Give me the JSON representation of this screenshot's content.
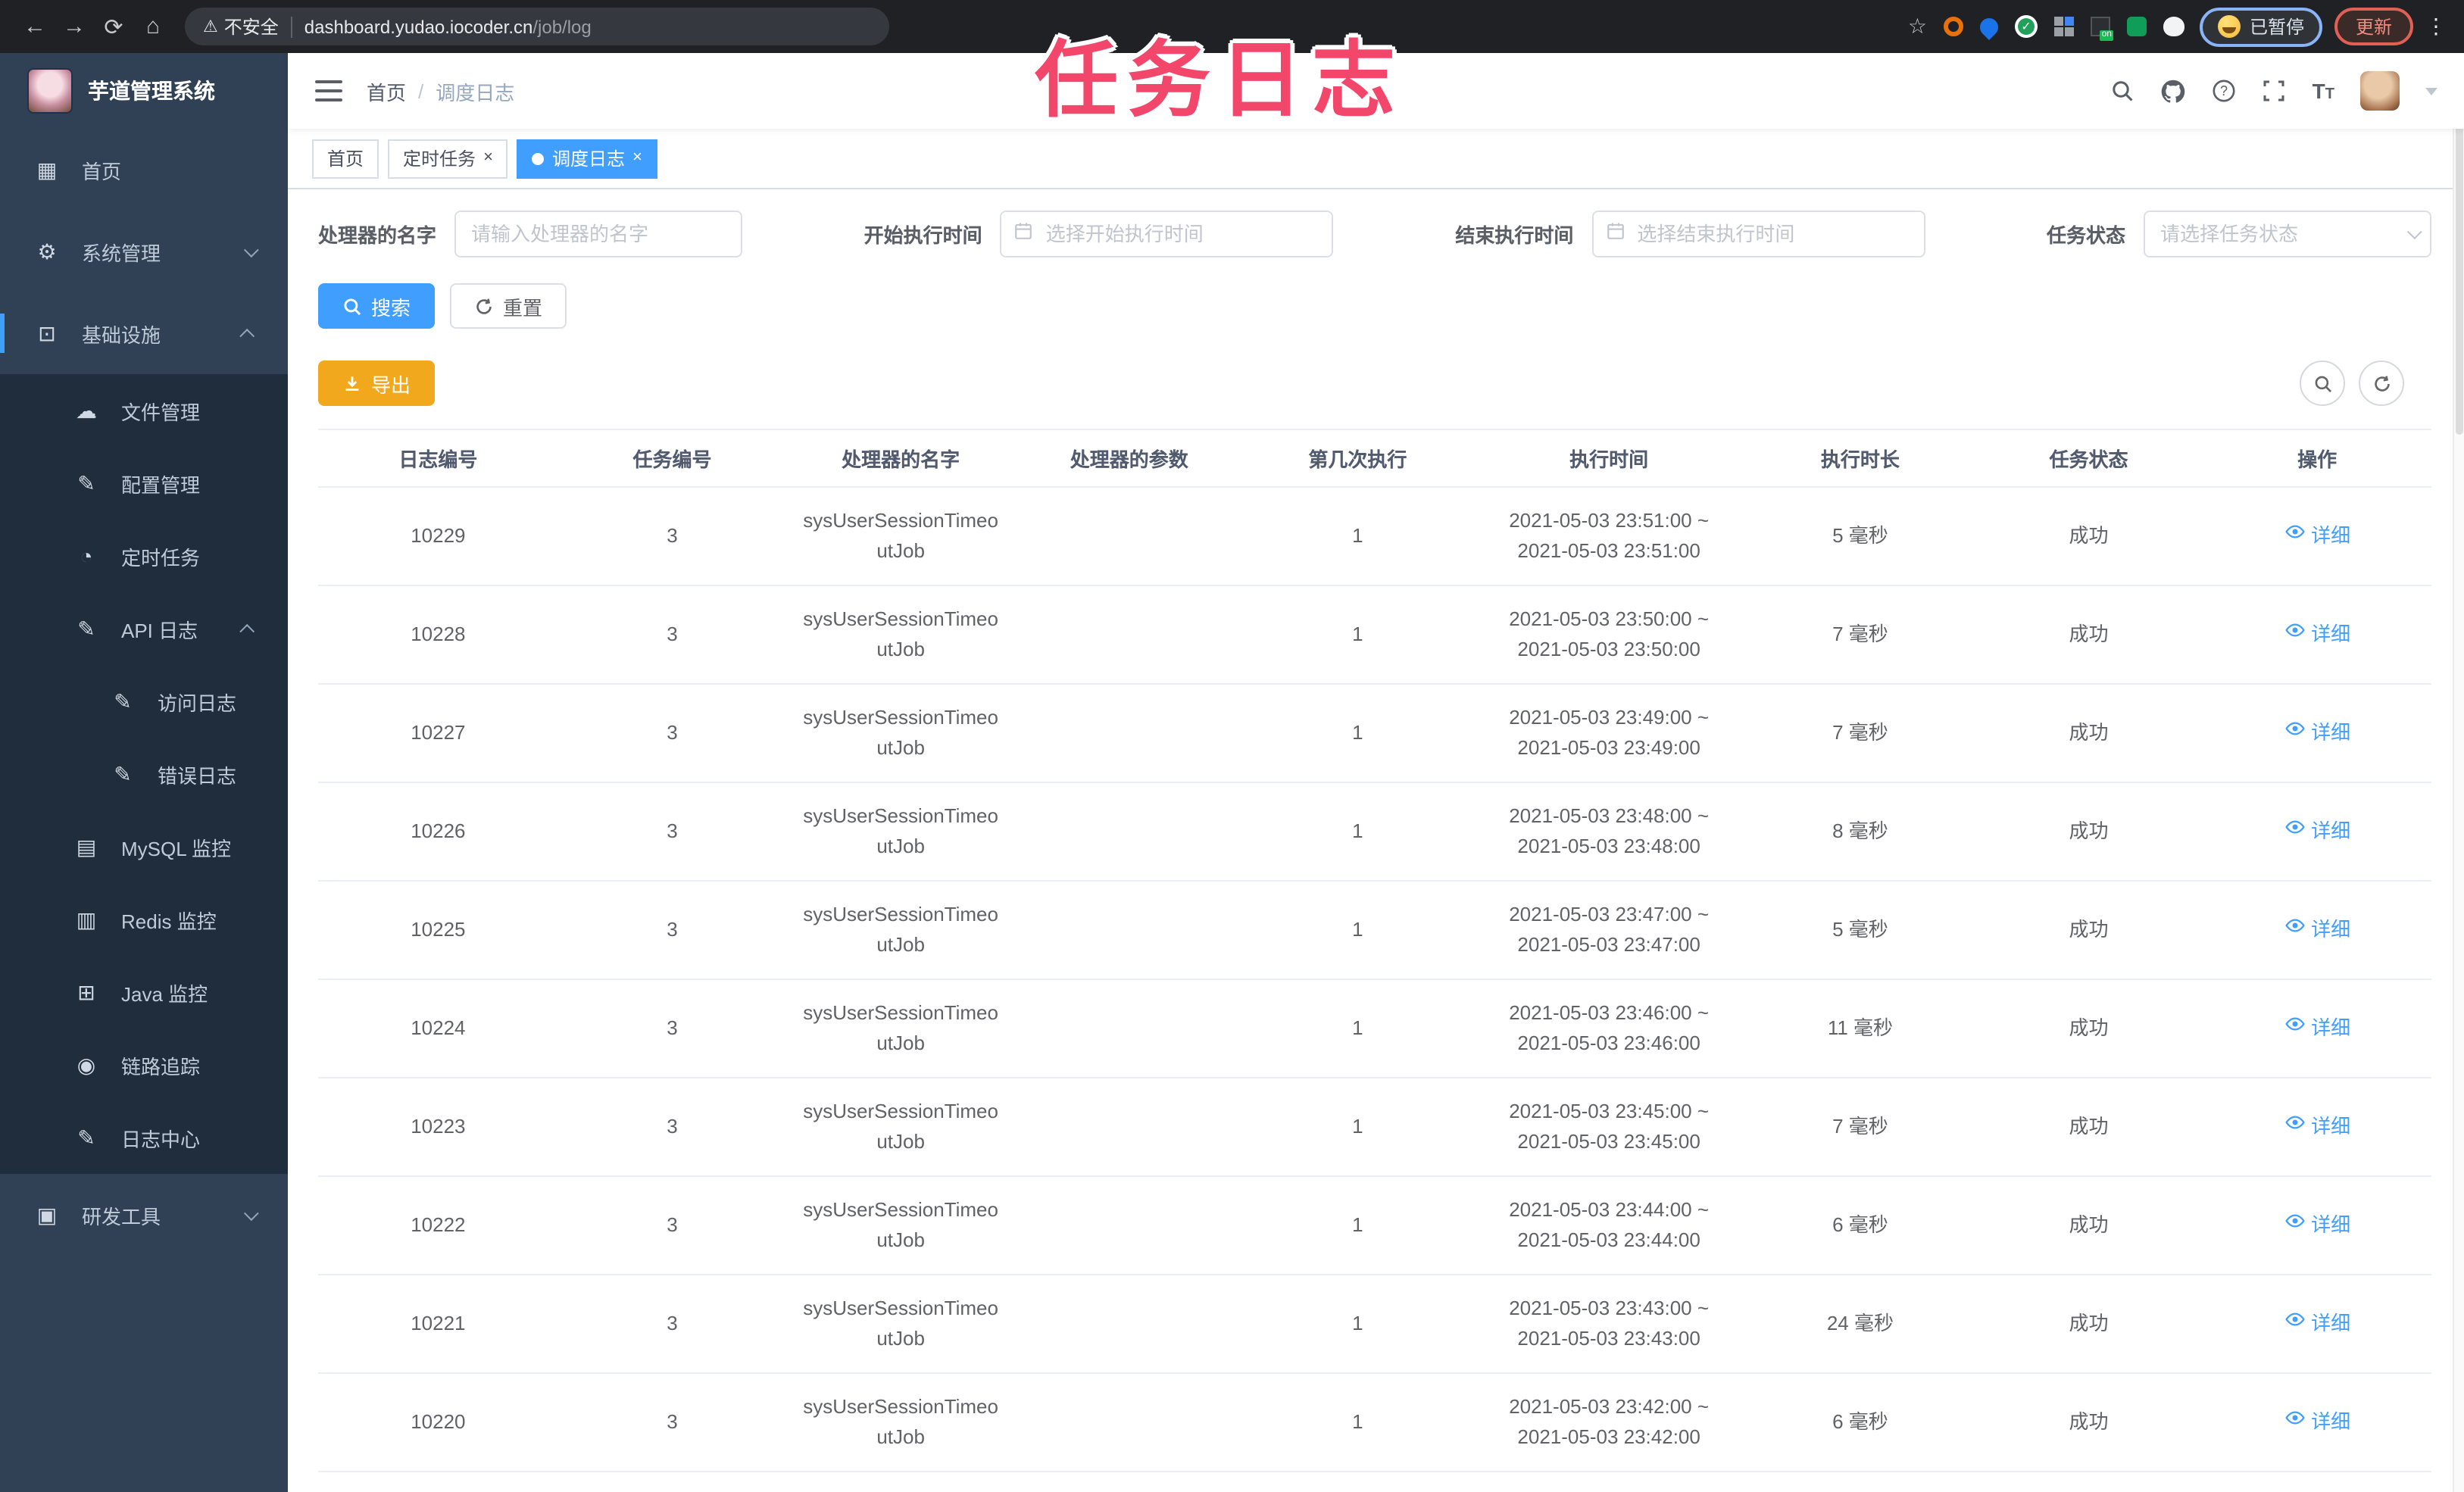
{
  "browser": {
    "security_label": "不安全",
    "url_host": "dashboard.yudao.iocoder.cn",
    "url_path": "/job/log",
    "profile_status": "已暂停",
    "update_label": "更新"
  },
  "annotation": {
    "text": "任务日志",
    "color": "#f2476a"
  },
  "sidebar": {
    "brand": "芋道管理系统",
    "items": [
      {
        "key": "home",
        "label": "首页",
        "icon": "dashboard-icon",
        "level": 0
      },
      {
        "key": "system-mgmt",
        "label": "系统管理",
        "icon": "gear-icon",
        "level": 0,
        "chevron": "down"
      },
      {
        "key": "infrastructure",
        "label": "基础设施",
        "icon": "monitor-icon",
        "level": 0,
        "chevron": "up",
        "active_bar": true
      },
      {
        "key": "file-mgmt",
        "label": "文件管理",
        "icon": "cloud-icon",
        "level": 1
      },
      {
        "key": "config-mgmt",
        "label": "配置管理",
        "icon": "edit-icon",
        "level": 1
      },
      {
        "key": "scheduled-jobs",
        "label": "定时任务",
        "icon": "timer-icon",
        "level": 1
      },
      {
        "key": "api-log",
        "label": "API 日志",
        "icon": "log-icon",
        "level": 1,
        "chevron": "up"
      },
      {
        "key": "access-log",
        "label": "访问日志",
        "icon": "log-icon",
        "level": 2
      },
      {
        "key": "error-log",
        "label": "错误日志",
        "icon": "log-icon",
        "level": 2
      },
      {
        "key": "mysql-monitor",
        "label": "MySQL 监控",
        "icon": "database-icon",
        "level": 1
      },
      {
        "key": "redis-monitor",
        "label": "Redis 监控",
        "icon": "stack-icon",
        "level": 1
      },
      {
        "key": "java-monitor",
        "label": "Java 监控",
        "icon": "screen-icon",
        "level": 1
      },
      {
        "key": "trace",
        "label": "链路追踪",
        "icon": "eye-icon",
        "level": 1
      },
      {
        "key": "log-center",
        "label": "日志中心",
        "icon": "log-icon",
        "level": 1
      },
      {
        "key": "dev-tools",
        "label": "研发工具",
        "icon": "briefcase-icon",
        "level": 0,
        "chevron": "down"
      }
    ]
  },
  "navbar": {
    "breadcrumb": {
      "home": "首页",
      "separator": "/",
      "current": "调度日志"
    }
  },
  "tabs": [
    {
      "key": "home",
      "label": "首页",
      "closable": false,
      "active": false
    },
    {
      "key": "job",
      "label": "定时任务",
      "closable": true,
      "active": false
    },
    {
      "key": "job-log",
      "label": "调度日志",
      "closable": true,
      "active": true
    }
  ],
  "filters": {
    "fields": [
      {
        "key": "handler-name",
        "label": "处理器的名字",
        "type": "text",
        "placeholder": "请输入处理器的名字"
      },
      {
        "key": "begin-time",
        "label": "开始执行时间",
        "type": "date",
        "placeholder": "选择开始执行时间"
      },
      {
        "key": "end-time",
        "label": "结束执行时间",
        "type": "date",
        "placeholder": "选择结束执行时间"
      },
      {
        "key": "job-status",
        "label": "任务状态",
        "type": "select",
        "placeholder": "请选择任务状态"
      }
    ],
    "search_label": "搜索",
    "reset_label": "重置"
  },
  "toolbar": {
    "export_label": "导出"
  },
  "table": {
    "columns": [
      "日志编号",
      "任务编号",
      "处理器的名字",
      "处理器的参数",
      "第几次执行",
      "执行时间",
      "执行时长",
      "任务状态",
      "操作"
    ],
    "time_separator": "~",
    "action_label": "详细",
    "rows": [
      {
        "log_id": "10229",
        "task_id": "3",
        "handler": "sysUserSessionTimeoutJob",
        "param": "",
        "index": "1",
        "start": "2021-05-03 23:51:00",
        "end": "2021-05-03 23:51:00",
        "duration": "5 毫秒",
        "status": "成功"
      },
      {
        "log_id": "10228",
        "task_id": "3",
        "handler": "sysUserSessionTimeoutJob",
        "param": "",
        "index": "1",
        "start": "2021-05-03 23:50:00",
        "end": "2021-05-03 23:50:00",
        "duration": "7 毫秒",
        "status": "成功"
      },
      {
        "log_id": "10227",
        "task_id": "3",
        "handler": "sysUserSessionTimeoutJob",
        "param": "",
        "index": "1",
        "start": "2021-05-03 23:49:00",
        "end": "2021-05-03 23:49:00",
        "duration": "7 毫秒",
        "status": "成功"
      },
      {
        "log_id": "10226",
        "task_id": "3",
        "handler": "sysUserSessionTimeoutJob",
        "param": "",
        "index": "1",
        "start": "2021-05-03 23:48:00",
        "end": "2021-05-03 23:48:00",
        "duration": "8 毫秒",
        "status": "成功"
      },
      {
        "log_id": "10225",
        "task_id": "3",
        "handler": "sysUserSessionTimeoutJob",
        "param": "",
        "index": "1",
        "start": "2021-05-03 23:47:00",
        "end": "2021-05-03 23:47:00",
        "duration": "5 毫秒",
        "status": "成功"
      },
      {
        "log_id": "10224",
        "task_id": "3",
        "handler": "sysUserSessionTimeoutJob",
        "param": "",
        "index": "1",
        "start": "2021-05-03 23:46:00",
        "end": "2021-05-03 23:46:00",
        "duration": "11 毫秒",
        "status": "成功"
      },
      {
        "log_id": "10223",
        "task_id": "3",
        "handler": "sysUserSessionTimeoutJob",
        "param": "",
        "index": "1",
        "start": "2021-05-03 23:45:00",
        "end": "2021-05-03 23:45:00",
        "duration": "7 毫秒",
        "status": "成功"
      },
      {
        "log_id": "10222",
        "task_id": "3",
        "handler": "sysUserSessionTimeoutJob",
        "param": "",
        "index": "1",
        "start": "2021-05-03 23:44:00",
        "end": "2021-05-03 23:44:00",
        "duration": "6 毫秒",
        "status": "成功"
      },
      {
        "log_id": "10221",
        "task_id": "3",
        "handler": "sysUserSessionTimeoutJob",
        "param": "",
        "index": "1",
        "start": "2021-05-03 23:43:00",
        "end": "2021-05-03 23:43:00",
        "duration": "24 毫秒",
        "status": "成功"
      },
      {
        "log_id": "10220",
        "task_id": "3",
        "handler": "sysUserSessionTimeoutJob",
        "param": "",
        "index": "1",
        "start": "2021-05-03 23:42:00",
        "end": "2021-05-03 23:42:00",
        "duration": "6 毫秒",
        "status": "成功"
      }
    ]
  },
  "colors": {
    "accent": "#409eff",
    "export_button": "#f2a81d",
    "sidebar_bg": "#304156",
    "submenu_bg": "#1f2d3d",
    "annotation": "#f2476a"
  }
}
